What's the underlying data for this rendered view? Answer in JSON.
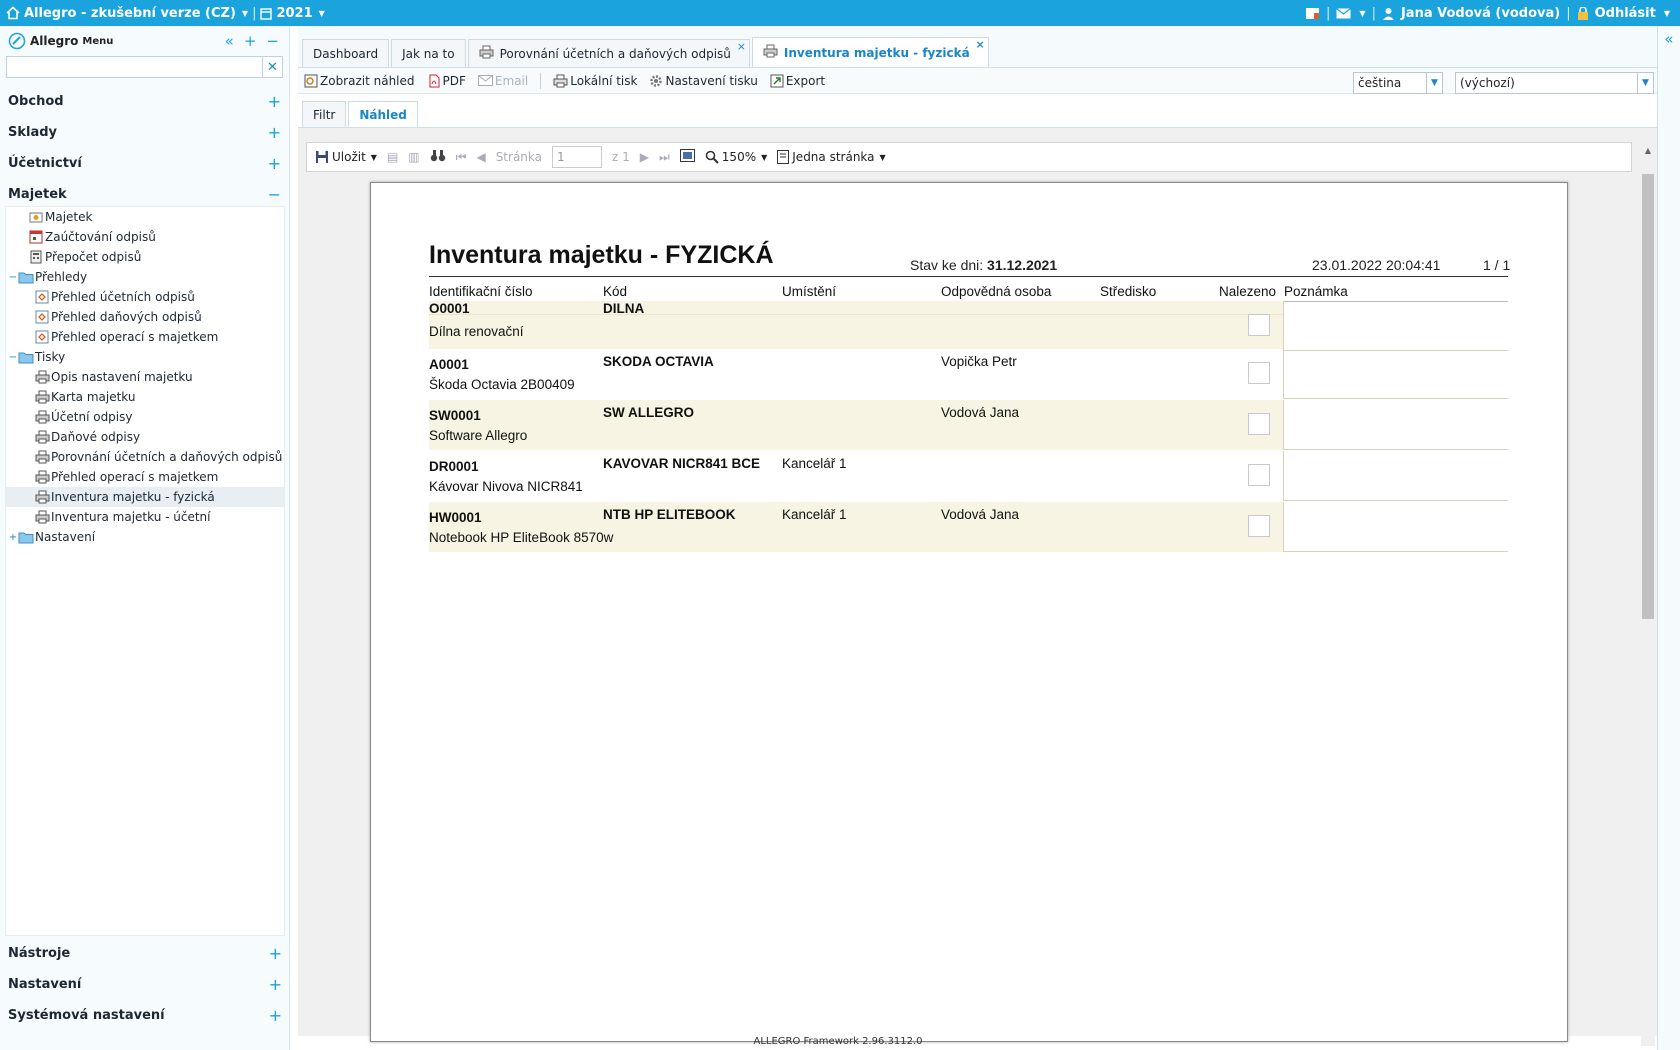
{
  "topbar": {
    "app_title": "Allegro - zkušební verze (CZ)",
    "year": "2021",
    "user": "Jana Vodová (vodova)",
    "logout": "Odhlásit",
    "sep": "|",
    "accent": "#1aa3dc"
  },
  "sidebar": {
    "logo": "Allegro",
    "menu": "Menu",
    "search_value": "",
    "sections_top": [
      "Obchod",
      "Sklady",
      "Účetnictví",
      "Majetek"
    ],
    "sections_bottom": [
      "Nástroje",
      "Nastavení",
      "Systémová nastavení"
    ],
    "tree": [
      {
        "label": "Majetek",
        "level": 1,
        "icon": "asset-icon"
      },
      {
        "label": "Zaúčtování odpisů",
        "level": 1,
        "icon": "calendar-icon"
      },
      {
        "label": "Přepočet odpisů",
        "level": 1,
        "icon": "calculator-icon"
      },
      {
        "label": "Přehledy",
        "level": 1,
        "icon": "folder-icon",
        "toggle": "−"
      },
      {
        "label": "Přehled účetních odpisů",
        "level": 2,
        "icon": "report-icon"
      },
      {
        "label": "Přehled daňových odpisů",
        "level": 2,
        "icon": "report-icon"
      },
      {
        "label": "Přehled operací s majetkem",
        "level": 2,
        "icon": "report-icon"
      },
      {
        "label": "Tisky",
        "level": 1,
        "icon": "folder-icon",
        "toggle": "−"
      },
      {
        "label": "Opis nastavení majetku",
        "level": 2,
        "icon": "printer-icon"
      },
      {
        "label": "Karta majetku",
        "level": 2,
        "icon": "printer-icon"
      },
      {
        "label": "Účetní odpisy",
        "level": 2,
        "icon": "printer-icon"
      },
      {
        "label": "Daňové odpisy",
        "level": 2,
        "icon": "printer-icon"
      },
      {
        "label": "Porovnání účetních a daňových odpisů",
        "level": 2,
        "icon": "printer-icon"
      },
      {
        "label": "Přehled operací s majetkem",
        "level": 2,
        "icon": "printer-icon"
      },
      {
        "label": "Inventura majetku - fyzická",
        "level": 2,
        "icon": "printer-icon",
        "selected": true
      },
      {
        "label": "Inventura majetku - účetní",
        "level": 2,
        "icon": "printer-icon"
      },
      {
        "label": "Nastavení",
        "level": 0,
        "icon": "folder-icon",
        "toggle": "+"
      }
    ]
  },
  "tabs": [
    {
      "label": "Dashboard"
    },
    {
      "label": "Jak na to"
    },
    {
      "label": "Porovnání účetních a daňových odpisů",
      "icon": true,
      "close": "×"
    },
    {
      "label": "Inventura majetku - fyzická",
      "icon": true,
      "close": "×",
      "active": true
    }
  ],
  "toolbar": {
    "preview": "Zobrazit náhled",
    "pdf": "PDF",
    "email": "Email",
    "local_print": "Lokální tisk",
    "print_settings": "Nastavení tisku",
    "export": "Export",
    "language": "čeština",
    "template": "(výchozí)"
  },
  "subtabs": {
    "filter": "Filtr",
    "preview": "Náhled"
  },
  "viewer": {
    "save": "Uložit",
    "page_label": "Stránka",
    "page_value": "1",
    "page_of": "z 1",
    "zoom": "150%",
    "view_mode": "Jedna stránka"
  },
  "report": {
    "title": "Inventura majetku - FYZICKÁ",
    "stav_label": "Stav ke dni:",
    "stav_value": "31.12.2021",
    "printed": "23.01.2022 20:04:41",
    "page": "1 / 1",
    "headers": {
      "id": "Identifikační číslo",
      "code": "Kód",
      "location": "Umístění",
      "person": "Odpovědná osoba",
      "center": "Středisko",
      "found": "Nalezeno",
      "note": "Poznámka"
    },
    "rows": [
      {
        "id": "O0001",
        "code": "DILNA",
        "location": "",
        "person": "",
        "name": "Dílna renovační"
      },
      {
        "id": "A0001",
        "code": "SKODA OCTAVIA",
        "location": "",
        "person": "Vopička Petr",
        "name": "Škoda Octavia 2B00409"
      },
      {
        "id": "SW0001",
        "code": "SW ALLEGRO",
        "location": "",
        "person": "Vodová Jana",
        "name": "Software Allegro"
      },
      {
        "id": "DR0001",
        "code": "KAVOVAR NICR841 BCE",
        "location": "Kancelář 1",
        "person": "",
        "name": "Kávovar Nivova NICR841"
      },
      {
        "id": "HW0001",
        "code": "NTB HP ELITEBOOK",
        "location": "Kancelář 1",
        "person": "Vodová Jana",
        "name": "Notebook HP EliteBook 8570w"
      }
    ],
    "stripe_color": "#f7f4e3"
  },
  "footer": "ALLEGRO Framework 2.96.3112.0"
}
